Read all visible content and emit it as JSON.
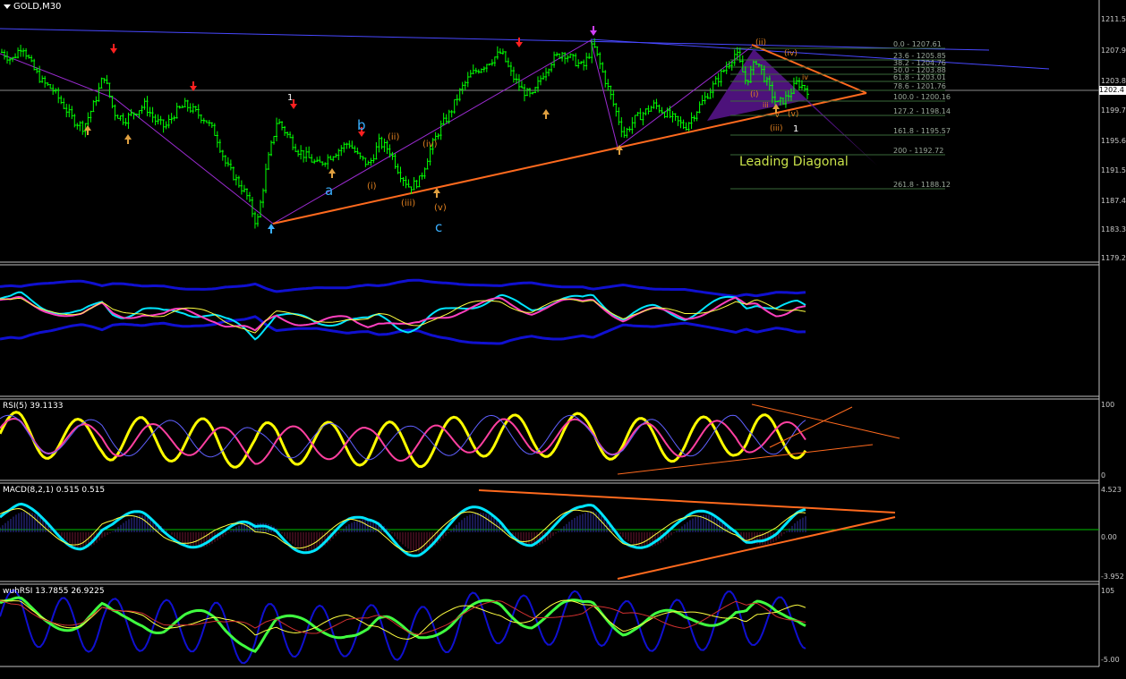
{
  "window": {
    "symbol_label": "GOLD,M30"
  },
  "colors": {
    "background": "#000000",
    "bull_candle": "#00ff00",
    "bear_candle": "#00ff00",
    "trendline": "#ff6a1e",
    "channel": "#3b3bff",
    "wedge": "#6a1aa0"
  },
  "price_axis": {
    "ticks": [
      "1211.5",
      "1207.9",
      "1203.8",
      "1199.7",
      "1195.6",
      "1191.5",
      "1187.4",
      "1183.3",
      "1179.2"
    ],
    "current": "1202.4"
  },
  "rsi_axis": {
    "ticks": [
      "100",
      "0"
    ]
  },
  "macd_axis": {
    "ticks": [
      "4.523",
      "0.00",
      "-3.952"
    ]
  },
  "wpr_axis": {
    "ticks": [
      "105",
      "-5.00"
    ]
  },
  "indicators": {
    "rsi_label": "RSI(5) 39.1133",
    "macd_label": "MACD(8,2,1) 0.515 0.515",
    "wrsi_label": "wuhRSI 13.7855 26.9225"
  },
  "waves": {
    "w1": "1",
    "wa": "a",
    "wb": "b",
    "wc": "c",
    "wi": "(i)",
    "wii": "(ii)",
    "wiii": "(iii)",
    "wiv": "(iv)",
    "wv": "(v)",
    "r_ii": "(ii)",
    "r_iv": "(iv)",
    "r_i": "(i)",
    "r_iii": "(iii)",
    "r_v": "(v)",
    "r_small_v": "v",
    "r_small_iii": "iii",
    "r_small_iv": "iv",
    "r_one": "1"
  },
  "fib_levels": [
    "0.0 - 1207.61",
    "23.6 - 1205.85",
    "38.2 - 1204.76",
    "50.0 - 1203.88",
    "61.8 - 1203.01",
    "78.6 - 1201.76",
    "100.0 - 1200.16",
    "127.2 - 1198.14",
    "161.8 - 1195.57",
    "200 - 1192.72",
    "261.8 - 1188.12"
  ],
  "annotation": {
    "leading_diagonal": "Leading Diagonal"
  },
  "chart_data": {
    "type": "table",
    "title": "GOLD,M30",
    "ylim": [
      1179.2,
      1213.0
    ],
    "price_series": [
      1207,
      1206,
      1208,
      1205,
      1203,
      1202,
      1200,
      1198,
      1197,
      1200,
      1204,
      1199,
      1198,
      1199,
      1200,
      1198,
      1197,
      1199,
      1200,
      1199,
      1198,
      1196,
      1192,
      1190,
      1188,
      1184,
      1192,
      1198,
      1196,
      1194,
      1193,
      1192,
      1193,
      1194,
      1195,
      1193,
      1192,
      1195,
      1194,
      1191,
      1189,
      1190,
      1194,
      1197,
      1199,
      1202,
      1204,
      1205,
      1206,
      1207,
      1204,
      1202,
      1201,
      1204,
      1206,
      1207,
      1206,
      1205,
      1208,
      1204,
      1200,
      1196,
      1198,
      1199,
      1200,
      1199,
      1198,
      1197,
      1199,
      1201,
      1203,
      1205,
      1207,
      1203,
      1206,
      1203,
      1200,
      1201,
      1203,
      1202
    ]
  }
}
